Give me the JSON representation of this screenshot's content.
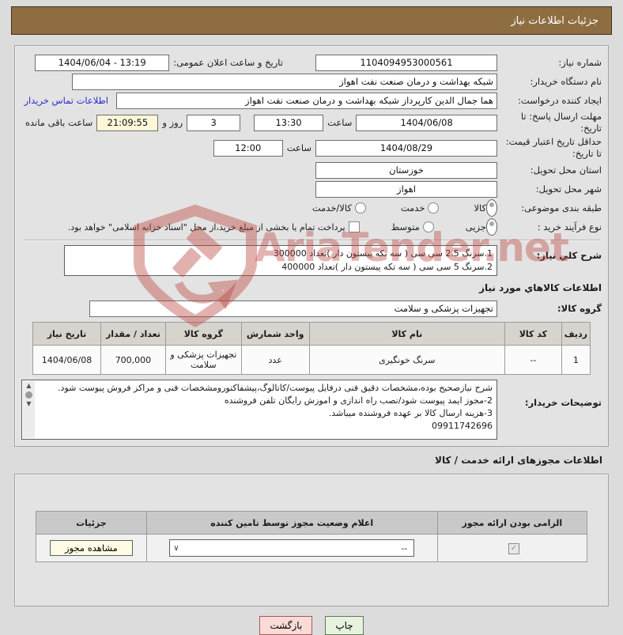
{
  "title_bar": {
    "text": "جزئیات اطلاعات نیاز"
  },
  "form": {
    "need_number": {
      "label": "شماره نیاز:",
      "value": "1104094953000561"
    },
    "announce_datetime": {
      "label": "تاریخ و ساعت اعلان عمومی:",
      "value": "1404/06/04 - 13:19"
    },
    "buyer_org": {
      "label": "نام دستگاه خریدار:",
      "value": "شبکه بهداشت و درمان صنعت نفت اهواز"
    },
    "request_creator": {
      "label": "ایجاد کننده درخواست:",
      "value": "هما جمال الدین کارپرداز شبکه بهداشت و درمان صنعت نفت اهواز",
      "contact_link": "اطلاعات تماس خریدار"
    },
    "response_deadline": {
      "label": "مهلت ارسال پاسخ: تا تاریخ:",
      "date": "1404/06/08",
      "hour_label": "ساعت",
      "time": "13:30",
      "days_value": "3",
      "days_label": "روز و",
      "remaining_time": "21:09:55",
      "remaining_label": "ساعت باقی مانده"
    },
    "price_validity": {
      "label": "حداقل تاریخ اعتبار قیمت: تا تاریخ:",
      "date": "1404/08/29",
      "hour_label": "ساعت",
      "time": "12:00"
    },
    "delivery_province": {
      "label": "استان محل تحویل:",
      "value": "خوزستان"
    },
    "delivery_city": {
      "label": "شهر محل تحویل:",
      "value": "اهواز"
    },
    "subject_class": {
      "label": "طبقه بندی موضوعی:",
      "options": [
        "کالا",
        "خدمت",
        "کالا/خدمت"
      ],
      "selected": "کالا"
    },
    "purchase_type": {
      "label": "نوع فرآیند خرید :",
      "options": [
        "جزیی",
        "متوسط"
      ],
      "selected": "جزیی",
      "treasury_note": "پرداخت تمام یا بخشی از مبلغ خرید،از محل \"اسناد خزانه اسلامی\" خواهد بود."
    },
    "need_desc": {
      "label": "شرح کلي نیاز:",
      "lines": [
        "1.سرنگ 2.5 سی سی ( سه تکه پیستون دار )تعداد 300000",
        "2.سرنگ 5 سی سی ( سه تکه پیستون دار )تعداد 400000"
      ]
    },
    "goods_info_header": "اطلاعات کالاهاي مورد نیاز",
    "goods_group": {
      "label": "گروه کالا:",
      "value": "تجهیزات پزشکی و سلامت"
    },
    "buyer_notes": {
      "label": "توضیحات خریدار:",
      "lines": [
        "شرح نیازصحیح بوده،مشخصات دقیق فنی درفایل پیوست/کاتالوگ،پیشفاکتورومشخصات فنی و مراکز فروش پیوست شود.",
        "2-مجوز ایمد پیوست شود/نصب راه اندازی و اموزش رایگان  تلفن فروشنده",
        "3-هزینه ارسال کالا بر عهده فروشنده میباشد.",
        "09911742696"
      ]
    }
  },
  "goods_table": {
    "headers": [
      "ردیف",
      "کد کالا",
      "نام کالا",
      "واحد شمارش",
      "گروه کالا",
      "تعداد / مقدار",
      "تاریخ نیاز"
    ],
    "rows": [
      [
        "1",
        "--",
        "سرنگ خونگیری",
        "عدد",
        "تجهیزات پزشکی و سلامت",
        "700,000",
        "1404/06/08"
      ]
    ]
  },
  "licenses": {
    "section_title": "اطلاعات مجوزهای ارائه خدمت / کالا",
    "headers": [
      "الزامی بودن ارائه مجوز",
      "اعلام وضعیت مجوز توسط تامین کننده",
      "جزئیات"
    ],
    "row": {
      "required_mark": "✓",
      "status_value": "--",
      "details_button": "مشاهده مجوز"
    }
  },
  "footer": {
    "print_button": "چاپ",
    "back_button": "بازگشت"
  },
  "watermark": {
    "text": "AriaTender.net",
    "color": "#bb443e"
  },
  "icons": {
    "chevron_down": "∨",
    "scroll_up": "▲",
    "scroll_down": "▼"
  }
}
